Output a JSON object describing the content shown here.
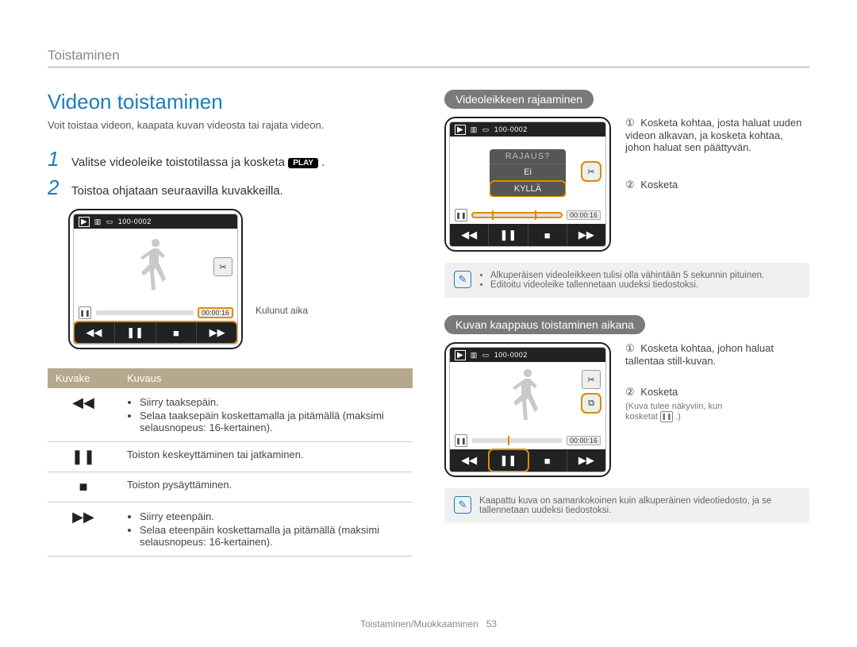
{
  "breadcrumb": "Toistaminen",
  "title": "Videon toistaminen",
  "intro": "Voit toistaa videon, kaapata kuvan videosta tai rajata videon.",
  "steps": [
    {
      "num": "1",
      "text_before": "Valitse videoleike toistotilassa ja kosketa ",
      "chip": "PLAY",
      "text_after": "."
    },
    {
      "num": "2",
      "text_before": "Toistoa ohjataan seuraavilla kuvakkeilla.",
      "chip": "",
      "text_after": ""
    }
  ],
  "main_screen": {
    "file_label": "100-0002",
    "time": "00:00:16",
    "elapsed_caption": "Kulunut aika"
  },
  "table": {
    "headers": [
      "Kuvake",
      "Kuvaus"
    ],
    "rows": [
      {
        "icon": "◀◀",
        "lines": [
          "Siirry taaksepäin.",
          "Selaa taaksepäin koskettamalla ja pitämällä (maksimi selausnopeus: 16-kertainen)."
        ]
      },
      {
        "icon": "❚❚",
        "plain": "Toiston keskeyttäminen tai jatkaminen."
      },
      {
        "icon": "■",
        "plain": "Toiston pysäyttäminen."
      },
      {
        "icon": "▶▶",
        "lines": [
          "Siirry eteenpäin.",
          "Selaa eteenpäin koskettamalla ja pitämällä (maksimi selausnopeus: 16-kertainen)."
        ]
      }
    ]
  },
  "trim": {
    "pill": "Videoleikkeen rajaaminen",
    "file_label": "100-0002",
    "time": "00:00:16",
    "dialog": {
      "title": "RAJAUS?",
      "no": "Ei",
      "yes": "KYLLÄ"
    },
    "note1": "Kosketa kohtaa, josta haluat uuden videon alkavan, ja kosketa kohtaa, johon haluat sen päättyvän.",
    "note2": "Kosketa",
    "box": [
      "Alkuperäisen videoleikkeen tulisi olla vähintään 5 sekunnin pituinen.",
      "Editoitu videoleike tallennetaan uudeksi tiedostoksi."
    ]
  },
  "capture": {
    "pill": "Kuvan kaappaus toistaminen aikana",
    "file_label": "100-0002",
    "time": "00:00:16",
    "note1": "Kosketa kohtaa, johon haluat tallentaa still-kuvan.",
    "note2": "Kosketa",
    "note2_sub_a": "(Kuva tulee näkyviin, kun",
    "note2_sub_b": "kosketat ",
    "note2_sub_c": ".)",
    "box": "Kaapattu kuva on samankokoinen kuin alkuperäinen videotiedosto, ja se tallennetaan uudeksi tiedostoksi."
  },
  "footer": {
    "section": "Toistaminen/Muokkaaminen",
    "page": "53"
  }
}
